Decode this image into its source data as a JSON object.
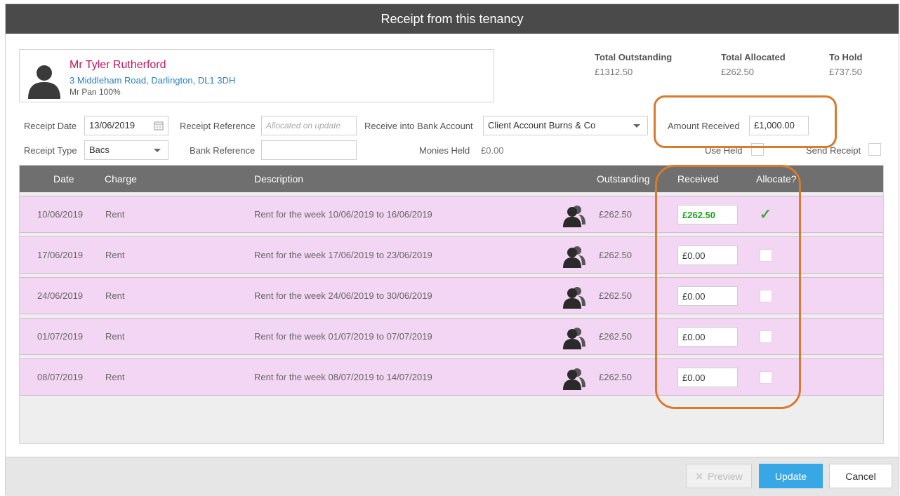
{
  "dialog": {
    "title": "Receipt from this tenancy"
  },
  "tenant": {
    "name": "Mr Tyler Rutherford",
    "address": "3 Middleham Road, Darlington, DL1 3DH",
    "share": "Mr Pan 100%"
  },
  "totals": {
    "outstanding_label": "Total Outstanding",
    "outstanding_value": "£1312.50",
    "allocated_label": "Total Allocated",
    "allocated_value": "£262.50",
    "hold_label": "To Hold",
    "hold_value": "£737.50"
  },
  "form": {
    "receipt_date_label": "Receipt Date",
    "receipt_date_value": "13/06/2019",
    "receipt_reference_label": "Receipt Reference",
    "receipt_reference_placeholder": "Allocated on update",
    "bank_account_label": "Receive into Bank Account",
    "bank_account_value": "Client Account Burns & Co",
    "amount_received_label": "Amount Received",
    "amount_received_value": "£1,000.00",
    "receipt_type_label": "Receipt Type",
    "receipt_type_value": "Bacs",
    "bank_reference_label": "Bank Reference",
    "bank_reference_value": "",
    "monies_held_label": "Monies Held",
    "monies_held_value": "£0.00",
    "use_held_label": "Use Held",
    "send_receipt_label": "Send Receipt"
  },
  "grid": {
    "columns": [
      "Date",
      "Charge",
      "Description",
      "Outstanding",
      "Received",
      "Allocate?"
    ],
    "rows": [
      {
        "date": "10/06/2019",
        "charge": "Rent",
        "description": "Rent for the week 10/06/2019 to 16/06/2019",
        "outstanding": "£262.50",
        "received": "£262.50",
        "allocate": true
      },
      {
        "date": "17/06/2019",
        "charge": "Rent",
        "description": "Rent for the week 17/06/2019 to 23/06/2019",
        "outstanding": "£262.50",
        "received": "£0.00",
        "allocate": false
      },
      {
        "date": "24/06/2019",
        "charge": "Rent",
        "description": "Rent for the week 24/06/2019 to 30/06/2019",
        "outstanding": "£262.50",
        "received": "£0.00",
        "allocate": false
      },
      {
        "date": "01/07/2019",
        "charge": "Rent",
        "description": "Rent for the week 01/07/2019 to 07/07/2019",
        "outstanding": "£262.50",
        "received": "£0.00",
        "allocate": false
      },
      {
        "date": "08/07/2019",
        "charge": "Rent",
        "description": "Rent for the week 08/07/2019 to 14/07/2019",
        "outstanding": "£262.50",
        "received": "£0.00",
        "allocate": false
      }
    ]
  },
  "footer": {
    "preview_label": "Preview",
    "update_label": "Update",
    "cancel_label": "Cancel"
  },
  "colors": {
    "title_bar": "#4a4a4a",
    "row_background": "#f3d6f3",
    "tenant_name": "#c2185b",
    "address": "#2a7fb8",
    "update_button": "#37a7e6",
    "highlight": "#d97a2e",
    "received_paid": "#1aa61a"
  }
}
